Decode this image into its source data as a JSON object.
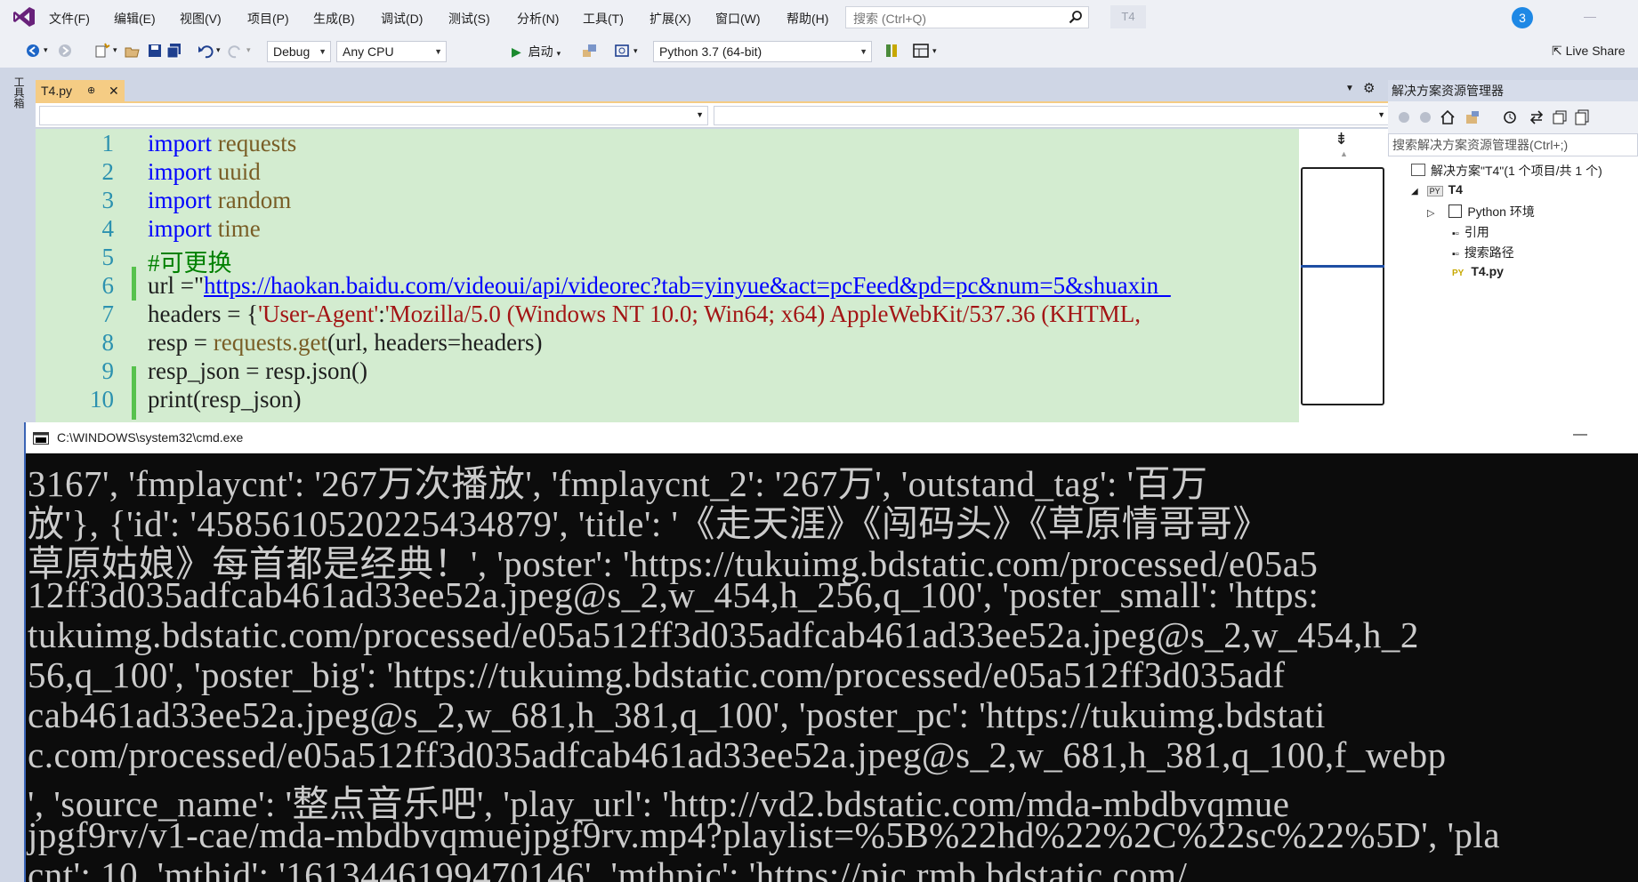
{
  "menubar": {
    "items": [
      "文件(F)",
      "编辑(E)",
      "视图(V)",
      "项目(P)",
      "生成(B)",
      "调试(D)",
      "测试(S)",
      "分析(N)",
      "工具(T)",
      "扩展(X)",
      "窗口(W)",
      "帮助(H)"
    ],
    "search_placeholder": "搜索 (Ctrl+Q)",
    "solution_badge": "T4",
    "notification_count": "3",
    "minimize_glyph": "—"
  },
  "toolbar": {
    "config": "Debug",
    "platform": "Any CPU",
    "start_label": "启动",
    "environment": "Python 3.7 (64-bit)",
    "liveshare": "Live Share"
  },
  "toolbox_label": "工具箱",
  "editor": {
    "tab_label": "T4.py",
    "tab_pin": "⊕",
    "tab_close": "✕",
    "line_numbers": [
      "1",
      "2",
      "3",
      "4",
      "5",
      "6",
      "7",
      "8",
      "9",
      "10"
    ],
    "lines": {
      "l1_kw": "import",
      "l1_mod": " requests",
      "l2_kw": "import",
      "l2_mod": " uuid",
      "l3_kw": "import",
      "l3_mod": " random",
      "l4_kw": "import",
      "l4_mod": " time",
      "l5_comment": "#可更换",
      "l6_pre": "url =\"",
      "l6_url": "https://haokan.baidu.com/videoui/api/videorec?tab=yinyue&act=pcFeed&pd=pc&num=5&shuaxin_",
      "l7_pre": "headers = {",
      "l7_key": "'User-Agent'",
      "l7_colon": ":",
      "l7_val": "'Mozilla/5.0 (Windows NT 10.0; Win64; x64) AppleWebKit/537.36 (KHTML,",
      "l8_pre": "resp = ",
      "l8_fn": "requests.get",
      "l8_post": "(url, headers=headers)",
      "l9": "resp_json = resp.json()",
      "l10": "print(resp_json)"
    }
  },
  "solution_explorer": {
    "title": "解决方案资源管理器",
    "search_placeholder": "搜索解决方案资源管理器(Ctrl+;)",
    "solution_node": "解决方案\"T4\"(1 个项目/共 1 个)",
    "project_node": "T4",
    "python_env": "Python 环境",
    "references": "引用",
    "search_paths": "搜索路径",
    "file_node": "T4.py",
    "py_badge": "PY"
  },
  "cmd": {
    "title": "C:\\WINDOWS\\system32\\cmd.exe",
    "minimize_glyph": "—",
    "lines": [
      "3167', 'fmplaycnt': '267万次播放', 'fmplaycnt_2': '267万', 'outstand_tag': '百万",
      "放'}, {'id': '4585610520225434879', 'title': '《走天涯》《闯码头》《草原情哥哥》",
      "草原姑娘》每首都是经典！', 'poster': 'https://tukuimg.bdstatic.com/processed/e05a5",
      "12ff3d035adfcab461ad33ee52a.jpeg@s_2,w_454,h_256,q_100', 'poster_small': 'https:",
      "tukuimg.bdstatic.com/processed/e05a512ff3d035adfcab461ad33ee52a.jpeg@s_2,w_454,h_2",
      "56,q_100', 'poster_big': 'https://tukuimg.bdstatic.com/processed/e05a512ff3d035adf",
      "cab461ad33ee52a.jpeg@s_2,w_681,h_381,q_100', 'poster_pc': 'https://tukuimg.bdstati",
      "c.com/processed/e05a512ff3d035adfcab461ad33ee52a.jpeg@s_2,w_681,h_381,q_100,f_webp",
      "', 'source_name': '整点音乐吧', 'play_url': 'http://vd2.bdstatic.com/mda-mbdbvqmue",
      "jpgf9rv/v1-cae/mda-mbdbvqmuejpgf9rv.mp4?playlist=%5B%22hd%22%2C%22sc%22%5D', 'pla",
      "cnt': 10, 'mthid': '1613446199470146', 'mthpic': 'https://pic.rmb.bdstatic.com/"
    ]
  },
  "colors": {
    "editor_bg": "#d3ecd0",
    "keyword": "#0000ff",
    "comment": "#008000",
    "string": "#a31515",
    "line_number": "#2b91af",
    "tab_active": "#f5cc84",
    "cmd_bg": "#0c0c0c",
    "cmd_text": "#cccccc"
  }
}
